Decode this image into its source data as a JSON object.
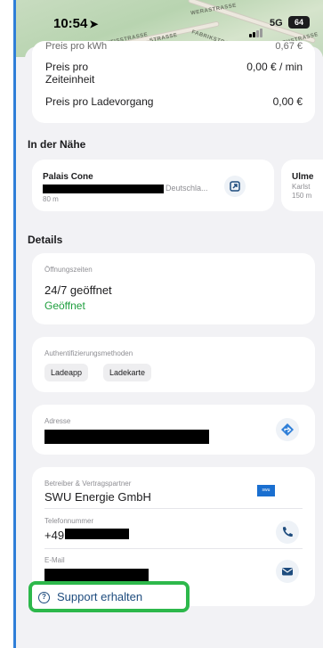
{
  "status_bar": {
    "time": "10:54",
    "network": "5G",
    "battery": "64"
  },
  "map": {
    "streets": [
      "WERASTRASSE",
      "SANTISSTRASSE",
      "STRASSE",
      "FABRIKSTRASSE",
      "ARTHSTRASSE"
    ]
  },
  "pricing": {
    "cut_label": "Preis pro kWh",
    "cut_value": "0,67 €",
    "time_label_line1": "Preis pro",
    "time_label_line2": "Zeiteinheit",
    "time_value": "0,00 € / min",
    "session_label": "Preis pro Ladevorgang",
    "session_value": "0,00 €"
  },
  "nearby": {
    "heading": "In der Nähe",
    "items": [
      {
        "name": "Palais Cone",
        "address_suffix": "Deutschla...",
        "distance": "80 m"
      },
      {
        "name": "Ulme",
        "address": "Karlst",
        "distance": "150 m"
      }
    ]
  },
  "details": {
    "heading": "Details",
    "hours_label": "Öffnungszeiten",
    "hours_value": "24/7 geöffnet",
    "hours_status": "Geöffnet",
    "auth_label": "Authentifizierungsmethoden",
    "auth_methods": [
      "Ladeapp",
      "Ladekarte"
    ],
    "address_label": "Adresse",
    "operator_label": "Betreiber & Vertragspartner",
    "operator_value": "SWU Energie GmbH",
    "operator_logo": "swu",
    "phone_label": "Telefonnummer",
    "phone_prefix": "+49",
    "email_label": "E-Mail"
  },
  "support": {
    "label": "Support erhalten"
  },
  "colors": {
    "accent": "#1e4c7e",
    "open_green": "#1e9e3e",
    "highlight": "#2db84b",
    "logo_blue": "#1a6fd0"
  }
}
